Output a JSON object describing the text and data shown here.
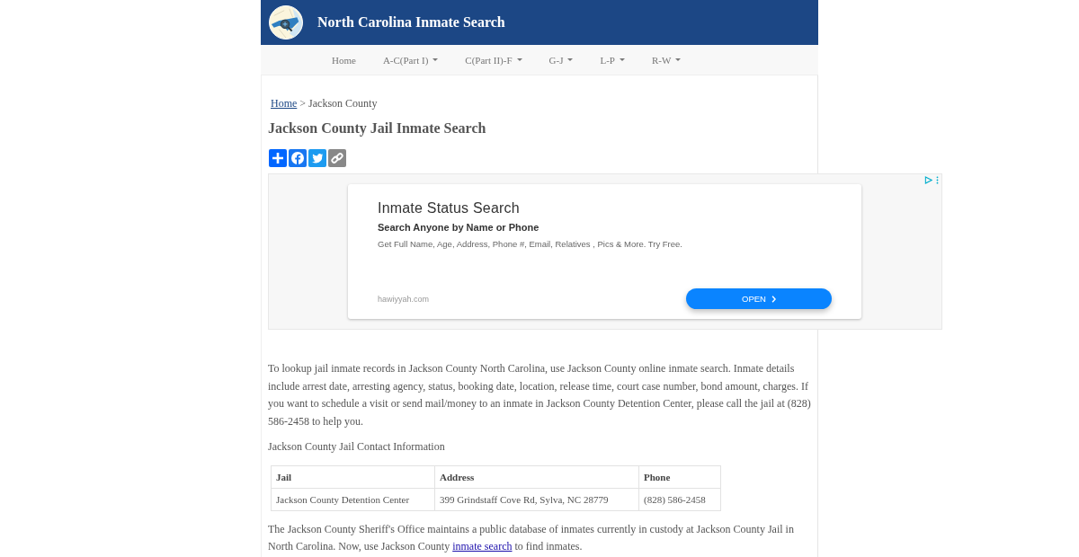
{
  "header": {
    "title": "North Carolina Inmate Search"
  },
  "nav": {
    "items": [
      {
        "label": "Home",
        "kind": "link"
      },
      {
        "label": "A-C(Part I)",
        "kind": "dropdown"
      },
      {
        "label": "C(Part II)-F",
        "kind": "dropdown"
      },
      {
        "label": "G-J",
        "kind": "dropdown"
      },
      {
        "label": "L-P",
        "kind": "dropdown"
      },
      {
        "label": "R-W",
        "kind": "dropdown"
      }
    ]
  },
  "breadcrumb": {
    "items": [
      {
        "label": "Home",
        "kind": "link"
      },
      {
        "label": "Jackson County",
        "kind": "current"
      }
    ],
    "separator": ">"
  },
  "heading": "Jackson County Jail Inmate Search",
  "ad": {
    "title": "Inmate Status Search",
    "subtitle": "Search Anyone by Name or Phone",
    "description": "Get Full Name, Age, Address, Phone #, Email, Relatives , Pics & More. Try Free.",
    "domain": "hawiyyah.com",
    "button": "OPEN"
  },
  "intro": "To lookup jail inmate records in Jackson County North Carolina, use Jackson County online inmate search. Inmate details include arrest date, arresting agency, status, booking date, location, release time, court case number, bond amount, charges. If you want to schedule a visit or send mail/money to an inmate in Jackson County Detention Center, please call the jail at (828) 586-2458 to help you.",
  "contact_heading": "Jackson County Jail Contact Information",
  "contact_table": {
    "columns": [
      "Jail",
      "Address",
      "Phone"
    ],
    "rows": [
      [
        "Jackson County Detention Center",
        "399 Grindstaff Cove Rd, Sylva, NC 28779",
        "(828) 586-2458"
      ]
    ]
  },
  "closing_paragraph": {
    "text_before": "The Jackson County Sheriff's Office maintains a public database of inmates currently in custody at Jackson County Jail in North Carolina. Now, use Jackson County ",
    "link": "inmate search",
    "text_after": " to find inmates."
  }
}
